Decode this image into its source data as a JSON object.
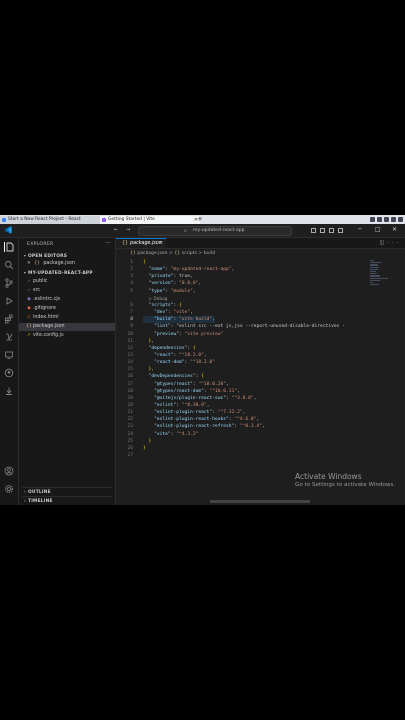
{
  "browser": {
    "tabs": [
      {
        "label": "Start a New React Project - React",
        "active": false
      },
      {
        "label": "Getting Started | Vite",
        "active": true
      }
    ],
    "new_tab": "+"
  },
  "titlebar": {
    "nav_back": "←",
    "nav_forward": "→",
    "search_text": "my-updated-react-app",
    "window_min": "─",
    "window_max": "□",
    "window_close": "✕"
  },
  "sidebar": {
    "title": "EXPLORER",
    "more": "···",
    "open_editors_label": "OPEN EDITORS",
    "open_editor": {
      "close": "✕",
      "icon": "{}",
      "name": "package.json"
    },
    "project_label": "MY-UPDATED-REACT-APP",
    "files": [
      {
        "name": "public",
        "icon": "›",
        "type": "folder"
      },
      {
        "name": "src",
        "icon": "›",
        "type": "folder"
      },
      {
        "name": ".eslintrc.cjs",
        "icon": "◉",
        "type": "file"
      },
      {
        "name": ".gitignore",
        "icon": "◆",
        "type": "file"
      },
      {
        "name": "index.html",
        "icon": "◇",
        "type": "file"
      },
      {
        "name": "package.json",
        "icon": "{}",
        "type": "file",
        "selected": true
      },
      {
        "name": "vite.config.js",
        "icon": "⚡",
        "type": "file"
      }
    ],
    "outline_label": "OUTLINE",
    "timeline_label": "TIMELINE"
  },
  "editor": {
    "tab": {
      "icon": "{}",
      "label": "package.json",
      "close": "✕"
    },
    "breadcrumb": {
      "icon": "{}",
      "file": "package.json",
      "sep1": ">",
      "icon2": "{}",
      "key1": "scripts",
      "sep2": ">",
      "key2": "build"
    },
    "codelens": "▷ Debug",
    "line_numbers": [
      "1",
      "2",
      "3",
      "4",
      "5",
      "6",
      "7",
      "8",
      "9",
      "10",
      "11",
      "12",
      "13",
      "14",
      "15",
      "16",
      "17",
      "18",
      "19",
      "20",
      "21",
      "22",
      "23",
      "24",
      "25",
      "26",
      "27"
    ],
    "current_line": "8",
    "lines": [
      "{",
      "  \"name\": \"my-updated-react-app\",",
      "  \"private\": true,",
      "  \"version\": \"0.0.0\",",
      "  \"type\": \"module\",",
      "  \"scripts\": {",
      "    \"dev\": \"vite\",",
      "    \"build\": \"vite build\",",
      "    \"lint\": \"eslint src --ext js,jsx --report-unused-disable-directives -",
      "    \"preview\": \"vite preview\"",
      "  },",
      "  \"dependencies\": {",
      "    \"react\": \"^18.2.0\",",
      "    \"react-dom\": \"^18.2.0\"",
      "  },",
      "  \"devDependencies\": {",
      "    \"@types/react\": \"^18.0.28\",",
      "    \"@types/react-dom\": \"^18.0.11\",",
      "    \"@vitejs/plugin-react-swc\": \"^3.0.0\",",
      "    \"eslint\": \"^8.38.0\",",
      "    \"eslint-plugin-react\": \"^7.32.2\",",
      "    \"eslint-plugin-react-hooks\": \"^4.6.0\",",
      "    \"eslint-plugin-react-refresh\": \"^0.3.4\",",
      "    \"vite\": \"^4.3.2\"",
      "  }",
      "}",
      ""
    ]
  },
  "activation": {
    "title": "Activate Windows",
    "subtitle": "Go to Settings to activate Windows."
  },
  "colors": {
    "editor_bg": "#1e1e1e",
    "sidebar_bg": "#181818",
    "accent": "#0078d4",
    "json_key": "#9cdcfe",
    "json_string": "#ce9178"
  }
}
